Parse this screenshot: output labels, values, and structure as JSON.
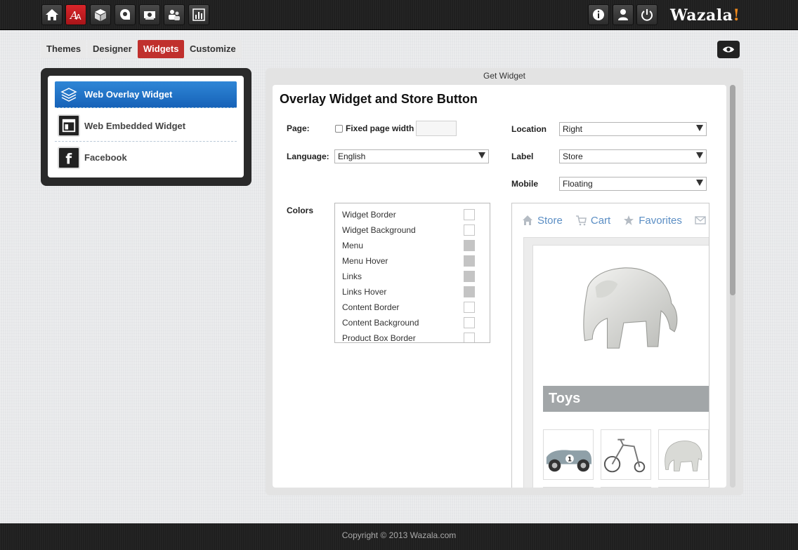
{
  "brand": {
    "name": "Wazala",
    "accent": "!"
  },
  "nav_icons": [
    "home-icon",
    "fonts-icon",
    "box-icon",
    "tag-icon",
    "money-icon",
    "users-icon",
    "chart-icon"
  ],
  "right_icons": [
    "info-icon",
    "user-icon",
    "power-icon"
  ],
  "tabs": [
    {
      "label": "Themes"
    },
    {
      "label": "Designer"
    },
    {
      "label": "Widgets"
    },
    {
      "label": "Customize"
    }
  ],
  "sidebar": {
    "items": [
      {
        "label": "Web Overlay Widget"
      },
      {
        "label": "Web Embedded Widget"
      },
      {
        "label": "Facebook"
      }
    ]
  },
  "main": {
    "panel_title": "Get Widget",
    "heading": "Overlay Widget and Store Button",
    "page_label": "Page:",
    "fixed_width_label": "Fixed page width",
    "language_label": "Language:",
    "language_value": "English",
    "location_label": "Location",
    "location_value": "Right",
    "label_label": "Label",
    "label_value": "Store",
    "mobile_label": "Mobile",
    "mobile_value": "Floating",
    "colors_label": "Colors",
    "colors": [
      {
        "name": "Widget Border"
      },
      {
        "name": "Widget Background"
      },
      {
        "name": "Menu"
      },
      {
        "name": "Menu Hover"
      },
      {
        "name": "Links"
      },
      {
        "name": "Links Hover"
      },
      {
        "name": "Content Border"
      },
      {
        "name": "Content Background"
      },
      {
        "name": "Product Box Border"
      }
    ]
  },
  "preview": {
    "nav": [
      {
        "label": "Store"
      },
      {
        "label": "Cart"
      },
      {
        "label": "Favorites"
      }
    ],
    "category": "Toys"
  },
  "footer": {
    "text": "Copyright © 2013 Wazala.com"
  },
  "colors": {
    "active_tab": "#c0302d",
    "sidebar_active": "#1e73c8",
    "link": "#5b8ec4",
    "brand_accent": "#f08a1c"
  }
}
